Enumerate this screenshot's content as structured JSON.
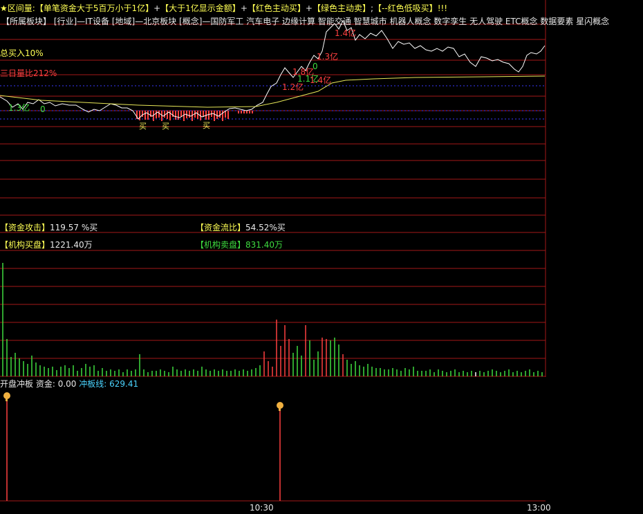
{
  "header": {
    "star": "★",
    "label": "区间量",
    "legend": [
      {
        "text": "【单笔资金大于5百万小于1亿】",
        "color": "#ffff54"
      },
      {
        "text": "+",
        "color": "#e8e8e8"
      },
      {
        "text": "【大于1亿显示金额】",
        "color": "#ffff54"
      },
      {
        "text": "+",
        "color": "#e8e8e8"
      },
      {
        "text": "【红色主动买】",
        "color": "#ffff54"
      },
      {
        "text": "+",
        "color": "#e8e8e8"
      },
      {
        "text": "【绿色主动卖】",
        "color": "#ffff54"
      },
      {
        "text": ";",
        "color": "#e8e8e8"
      },
      {
        "text": "【--红色低吸买】",
        "color": "#ffff54"
      },
      {
        "text": "!!!",
        "color": "#ffff54"
      }
    ]
  },
  "sector_line": "【所属板块】 [行业]—IT设备 [地域]—北京板块 [概念]—国防军工 汽车电子 边缘计算 智能交通 智慧城市 机器人概念 数字孪生 无人驾驶 ETC概念 数据要素 星闪概念",
  "labels": {
    "total_buy": "总买入10%",
    "three_day_ratio": "三日量比212%"
  },
  "trade_marks": [
    {
      "text": "1.3亿",
      "color": "#3fdc3f"
    },
    {
      "text": "0",
      "color": "#3fdc3f"
    },
    {
      "text": "1.2亿",
      "color": "#ff4040"
    },
    {
      "text": "1.8亿",
      "color": "#ff4040"
    },
    {
      "text": "1.1亿",
      "color": "#3fdc3f"
    },
    {
      "text": "1.4亿",
      "color": "#ff4040"
    },
    {
      "text": "1.3亿",
      "color": "#ff4040"
    },
    {
      "text": "1.4亿",
      "color": "#ff4040"
    },
    {
      "text": "0",
      "color": "#3fdc3f"
    }
  ],
  "buy_marks": [
    "买",
    "买",
    "买"
  ],
  "stats": {
    "attack": {
      "label": "【资金攻击】",
      "value": "119.57 %买"
    },
    "flow": {
      "label": "【资金流比】",
      "value": "54.52%买"
    },
    "inst_buy": {
      "label": "【机构买盘】",
      "value": "1221.40万"
    },
    "inst_sell": {
      "label": "【机构卖盘】",
      "value": "831.40万"
    }
  },
  "bottom_panel": {
    "title": "开盘冲板",
    "fund_label": "资金:",
    "fund_value": "0.00",
    "line_label": "冲板线:",
    "line_value": "629.41"
  },
  "time_axis": [
    "10:30",
    "13:00"
  ],
  "colors": {
    "grid": "#a51818",
    "price": "#ffffff",
    "avg": "#e8e858",
    "buy_bar": "#ff4040",
    "sell_bar": "#3fdc3f",
    "dotted": "#3a3aff"
  }
}
